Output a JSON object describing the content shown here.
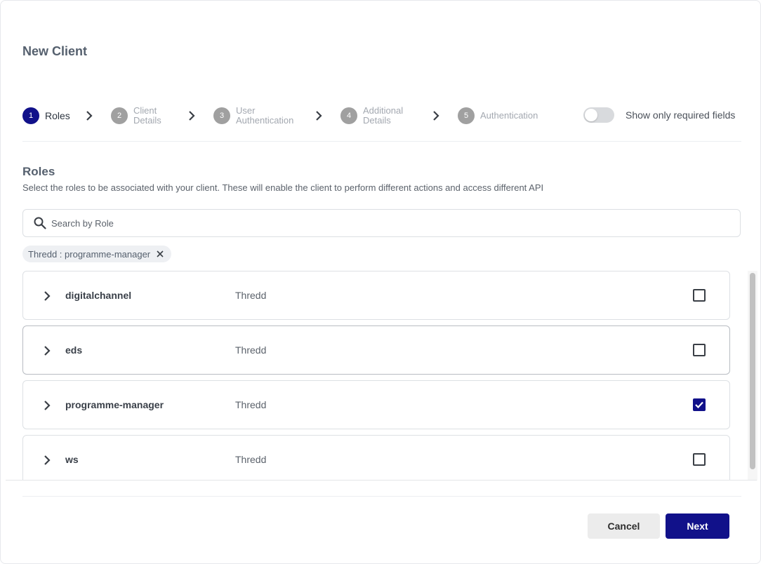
{
  "dialog": {
    "title": "New Client"
  },
  "stepper": {
    "steps": [
      {
        "number": "1",
        "label": "Roles",
        "label_line2": ""
      },
      {
        "number": "2",
        "label": "Client",
        "label_line2": "Details"
      },
      {
        "number": "3",
        "label": "User",
        "label_line2": "Authentication"
      },
      {
        "number": "4",
        "label": "Additional",
        "label_line2": "Details"
      },
      {
        "number": "5",
        "label": "Authentication",
        "label_line2": ""
      }
    ],
    "required_toggle": {
      "label": "Show only required fields",
      "on": false
    }
  },
  "roles_section": {
    "title": "Roles",
    "description": "Select the roles to be associated with your client. These will enable the client to perform different actions and access different API"
  },
  "search": {
    "placeholder": "Search by Role",
    "value": ""
  },
  "selected_chips": [
    {
      "label": "Thredd : programme-manager"
    }
  ],
  "roles": [
    {
      "name": "digitalchannel",
      "org": "Thredd",
      "checked": false
    },
    {
      "name": "eds",
      "org": "Thredd",
      "checked": false
    },
    {
      "name": "programme-manager",
      "org": "Thredd",
      "checked": true
    },
    {
      "name": "ws",
      "org": "Thredd",
      "checked": false
    }
  ],
  "footer": {
    "cancel_label": "Cancel",
    "next_label": "Next"
  },
  "colors": {
    "primary": "#11118a",
    "step_inactive": "#a0a0a0"
  },
  "icons": {
    "search": "search-icon",
    "chevron": "chevron-right-icon",
    "close": "close-icon",
    "check": "check-icon"
  }
}
